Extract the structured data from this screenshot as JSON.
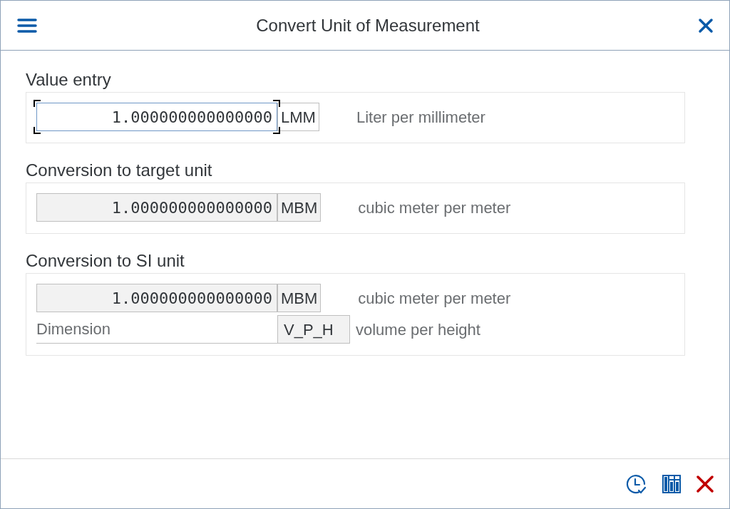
{
  "window": {
    "title": "Convert Unit of Measurement"
  },
  "sections": [
    {
      "title": "Value entry",
      "rows": [
        {
          "kind": "value",
          "value": "1.000000000000000",
          "editable": true,
          "unit": "LMM",
          "description": "Liter per millimeter"
        }
      ]
    },
    {
      "title": "Conversion to target unit",
      "rows": [
        {
          "kind": "value",
          "value": "1.000000000000000",
          "editable": false,
          "unit": "MBM",
          "description": "cubic meter per meter"
        }
      ]
    },
    {
      "title": "Conversion to SI unit",
      "rows": [
        {
          "kind": "value",
          "value": "1.000000000000000",
          "editable": false,
          "unit": "MBM",
          "description": "cubic meter per meter"
        },
        {
          "kind": "dimension",
          "label": "Dimension",
          "unit": "V_P_H",
          "description": "volume per height"
        }
      ]
    }
  ]
}
